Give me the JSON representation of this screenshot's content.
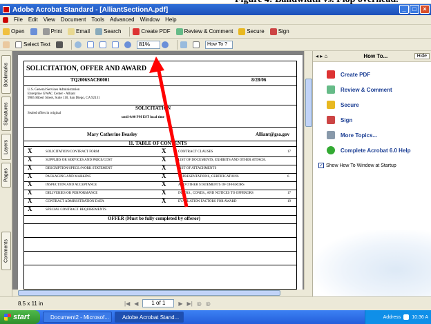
{
  "top_strip_text": "Figure 4: Bandwidth vs. Flop overhead.",
  "window": {
    "title": "Adobe Acrobat Standard - [AlliantSectionA.pdf]"
  },
  "menu": [
    "File",
    "Edit",
    "View",
    "Document",
    "Tools",
    "Advanced",
    "Window",
    "Help"
  ],
  "toolbar1": {
    "open": "Open",
    "save": "",
    "print": "Print",
    "email": "Email",
    "search": "Search",
    "create_pdf": "Create PDF",
    "review": "Review & Comment",
    "secure": "Secure",
    "sign": "Sign"
  },
  "toolbar2": {
    "select_text": "Select Text",
    "zoom": "81%",
    "how_to": "How To ?"
  },
  "nav_tabs": [
    "Bookmarks",
    "Signatures",
    "Layers",
    "Pages",
    "Comments"
  ],
  "document": {
    "title": "SOLICITATION, OFFER AND AWARD",
    "contract_no": "TQ2006SACB0001",
    "date_issued": "8/28/06",
    "issued_by": "U.S. General Services Administration",
    "issued_by_2": "Enterprise GWAC Center - Alliant",
    "issued_by_3": "9985 Hibert Street, Suite 110, San Diego, CA 92131",
    "section_title": "SOLICITATION",
    "contact_name": "Mary Catherine Beasley",
    "email": "Alliant@gsa.gov",
    "toc_title": "11. TABLE OF CONTENTS",
    "offer_title": "OFFER (Must be fully completed by offeror)",
    "sealed_line": "Sealed offers in original",
    "until_line": "until 4:00 PM EST local time",
    "rows_left": [
      "SOLICITATION/CONTRACT FORM",
      "SUPPLIES OR SERVICES AND PRICE/COST",
      "DESCRIPTION/SPECS./WORK STATEMENT",
      "PACKAGING AND MARKING",
      "INSPECTION AND ACCEPTANCE",
      "DELIVERIES OR PERFORMANCE",
      "CONTRACT ADMINISTRATION DATA",
      "SPECIAL CONTRACT REQUIREMENTS"
    ],
    "rows_right": [
      "CONTRACT CLAUSES",
      "LIST OF DOCUMENTS, EXHIBITS AND OTHER ATTACH.",
      "LIST OF ATTACHMENTS",
      "REPRESENTATIONS, CERTIFICATIONS",
      "AND OTHER STATEMENTS OF OFFERORS",
      "INSTRS., CONDS., AND NOTICES TO OFFERORS",
      "EVALUATION FACTORS FOR AWARD"
    ],
    "pages_right": [
      "17",
      "",
      "",
      "6",
      "",
      "17",
      "19"
    ]
  },
  "status": {
    "size": "8.5 x 11 in",
    "page": "1 of 1"
  },
  "how_to": {
    "title": "How To...",
    "hide": "Hide",
    "items": [
      "Create PDF",
      "Review & Comment",
      "Secure",
      "Sign",
      "More Topics...",
      "Complete Acrobat 6.0 Help"
    ],
    "startup": "Show How To Window at Startup"
  },
  "taskbar": {
    "start": "start",
    "tasks": [
      "Document2 - Microsof...",
      "Adobe Acrobat Stand..."
    ],
    "tray_text": "Address",
    "clock": "10:36 A"
  },
  "colors": {
    "titlebar": "#1d4fb8",
    "arrow": "#ff0000",
    "link": "#1c3f94"
  }
}
